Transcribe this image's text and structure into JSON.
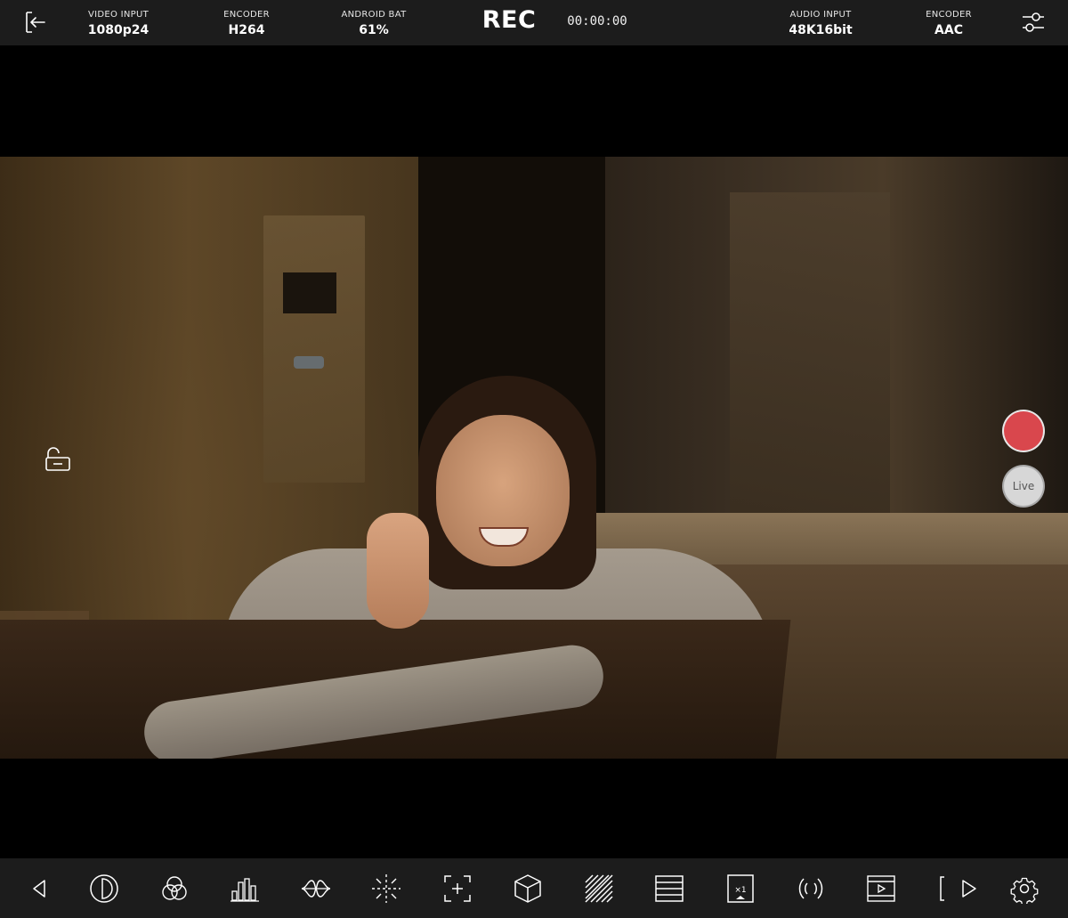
{
  "topbar": {
    "video_input": {
      "label": "VIDEO INPUT",
      "value": "1080p24"
    },
    "video_encoder": {
      "label": "ENCODER",
      "value": "H264"
    },
    "battery": {
      "label": "ANDROID BAT",
      "value": "61%"
    },
    "title": "REC",
    "timecode": "00:00:00",
    "audio_input": {
      "label": "AUDIO INPUT",
      "value": "48K16bit"
    },
    "audio_encoder": {
      "label": "ENCODER",
      "value": "AAC"
    },
    "icons": {
      "exit": "exit-icon",
      "settings": "sliders-icon"
    }
  },
  "overlay": {
    "lock_icon": "unlock-icon",
    "record_color": "#d9474d",
    "live_label": "Live"
  },
  "toolbar": {
    "tools": [
      "back-icon",
      "contrast-icon",
      "color-channels-icon",
      "histogram-icon",
      "waveform-icon",
      "focus-peaking-icon",
      "frame-guide-icon",
      "lut-cube-icon",
      "zebra-icon",
      "grid-lines-icon",
      "anamorphic-icon",
      "audio-signal-icon",
      "playback-icon",
      "bracket-play-icon",
      "settings-gear-icon"
    ]
  }
}
